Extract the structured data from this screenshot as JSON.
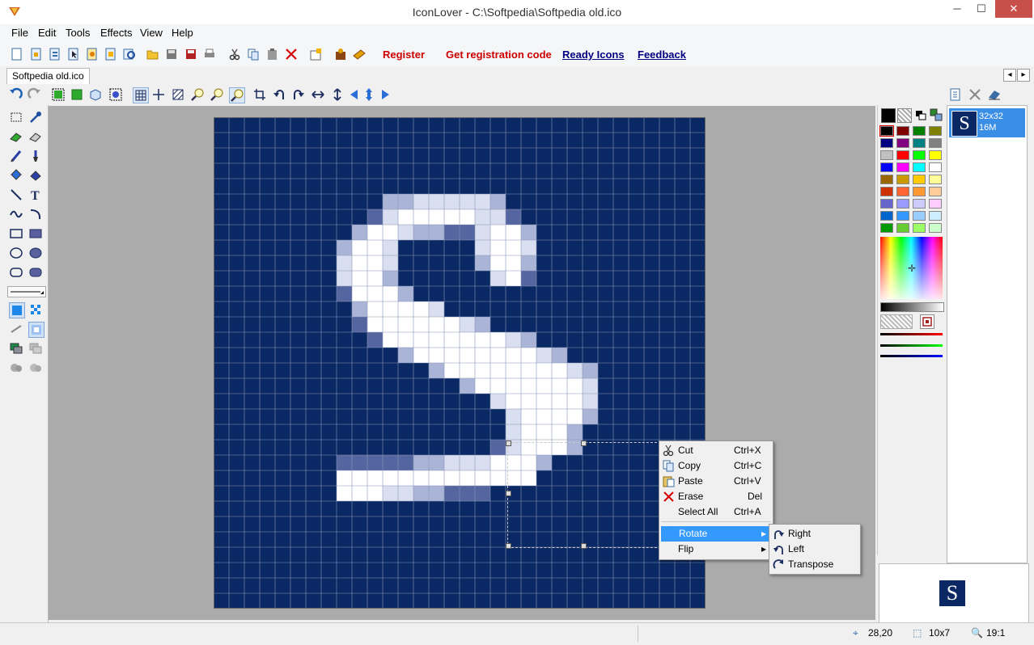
{
  "window": {
    "title": "IconLover - C:\\Softpedia\\Softpedia old.ico",
    "controls": [
      "─",
      "☐",
      "✕"
    ]
  },
  "menu": [
    "File",
    "Edit",
    "Tools",
    "Effects",
    "View",
    "Help"
  ],
  "toolbar": {
    "icons": [
      "new-icon",
      "new-image-icon",
      "new-library-icon",
      "new-cursor-icon",
      "new-animated-icon",
      "new-extra-icon",
      "find-icon",
      "open-icon",
      "save-icon",
      "save-all-icon",
      "print-icon",
      "cut-icon",
      "copy-icon",
      "paste-icon",
      "delete-icon",
      "properties-icon",
      "resources-icon",
      "book-icon"
    ],
    "links": [
      {
        "label": "Register",
        "color": "#cc0000",
        "underline": false
      },
      {
        "label": "Get registration code",
        "color": "#cc0000",
        "underline": false
      },
      {
        "label": "Ready Icons",
        "color": "#000080",
        "underline": true
      },
      {
        "label": "Feedback",
        "color": "#000080",
        "underline": true
      }
    ]
  },
  "tab": {
    "label": "Softpedia old.ico"
  },
  "context_menu": {
    "items": [
      {
        "label": "Cut",
        "shortcut": "Ctrl+X",
        "icon": "scissors-icon"
      },
      {
        "label": "Copy",
        "shortcut": "Ctrl+C",
        "icon": "copy-icon"
      },
      {
        "label": "Paste",
        "shortcut": "Ctrl+V",
        "icon": "paste-icon"
      },
      {
        "label": "Erase",
        "shortcut": "Del",
        "icon": "erase-x-icon"
      },
      {
        "label": "Select All",
        "shortcut": "Ctrl+A",
        "icon": ""
      },
      {
        "label": "Rotate",
        "shortcut": "",
        "icon": "",
        "submenu": true,
        "highlighted": true
      },
      {
        "label": "Flip",
        "shortcut": "",
        "icon": "",
        "submenu": true
      }
    ],
    "submenu": [
      {
        "label": "Right",
        "icon": "rotate-right-icon"
      },
      {
        "label": "Left",
        "icon": "rotate-left-icon"
      },
      {
        "label": "Transpose",
        "icon": "transpose-icon"
      }
    ]
  },
  "palette": {
    "colors": [
      "#000000",
      "#800000",
      "#008000",
      "#808000",
      "#000080",
      "#800080",
      "#008080",
      "#808080",
      "#c0c0c0",
      "#ff0000",
      "#00ff00",
      "#ffff00",
      "#0000ff",
      "#ff00ff",
      "#00ffff",
      "#ffffff",
      "#996600",
      "#cc9900",
      "#ffcc00",
      "#ffff99",
      "#cc3300",
      "#ff6633",
      "#ff9933",
      "#ffcc99",
      "#6666cc",
      "#9999ff",
      "#ccccff",
      "#ffccff",
      "#0066cc",
      "#3399ff",
      "#99ccff",
      "#cceeff",
      "#009900",
      "#66cc33",
      "#99ff66",
      "#ccffcc"
    ]
  },
  "formats": {
    "size": "32x32",
    "colors": "16M",
    "letter": "S"
  },
  "preview": {
    "letter": "S"
  },
  "status": {
    "coords": "28,20",
    "selection": "10x7",
    "zoom": "19:1"
  },
  "image": {
    "background": "#0a2863",
    "glyph_rows": [
      "................................",
      "................................",
      "................................",
      "................................",
      "................................",
      "...........ccbbbbbc.............",
      "..........dbwwwwwbbd............",
      ".........cwwbccddbwwc...........",
      "........cwwbnnnnnbwwb...........",
      "........bwwbnnnnncwwc...........",
      "........bwwcnnnnnnbwd...........",
      "........dwwwcnnnnnnnn...........",
      ".........cwwwwbnnnnnn...........",
      ".........dwwwwwwbcnnn...........",
      "..........dwwwwwwwwbc...........",
      "............cwwwwwwwwbc.........",
      "..............cwwwwwwwwbc.......",
      "................cwwwwwwwb.......",
      "..................bwwwwwb.......",
      "...................bwwwwc.......",
      "...................bwwwc........",
      "..................dbwwwc........",
      "........dddddccbbbwwwc..........",
      "........wwwwwwwwwwwww...........",
      "........wwwbbccddd..............",
      "................................",
      "................................",
      "................................",
      "................................",
      "................................",
      "................................",
      "................................"
    ],
    "shade_colors": {
      "w": "#ffffff",
      "b": "#d9dff0",
      "c": "#a9b4d6",
      "d": "#5565a0",
      "n": "#0a2863"
    }
  }
}
